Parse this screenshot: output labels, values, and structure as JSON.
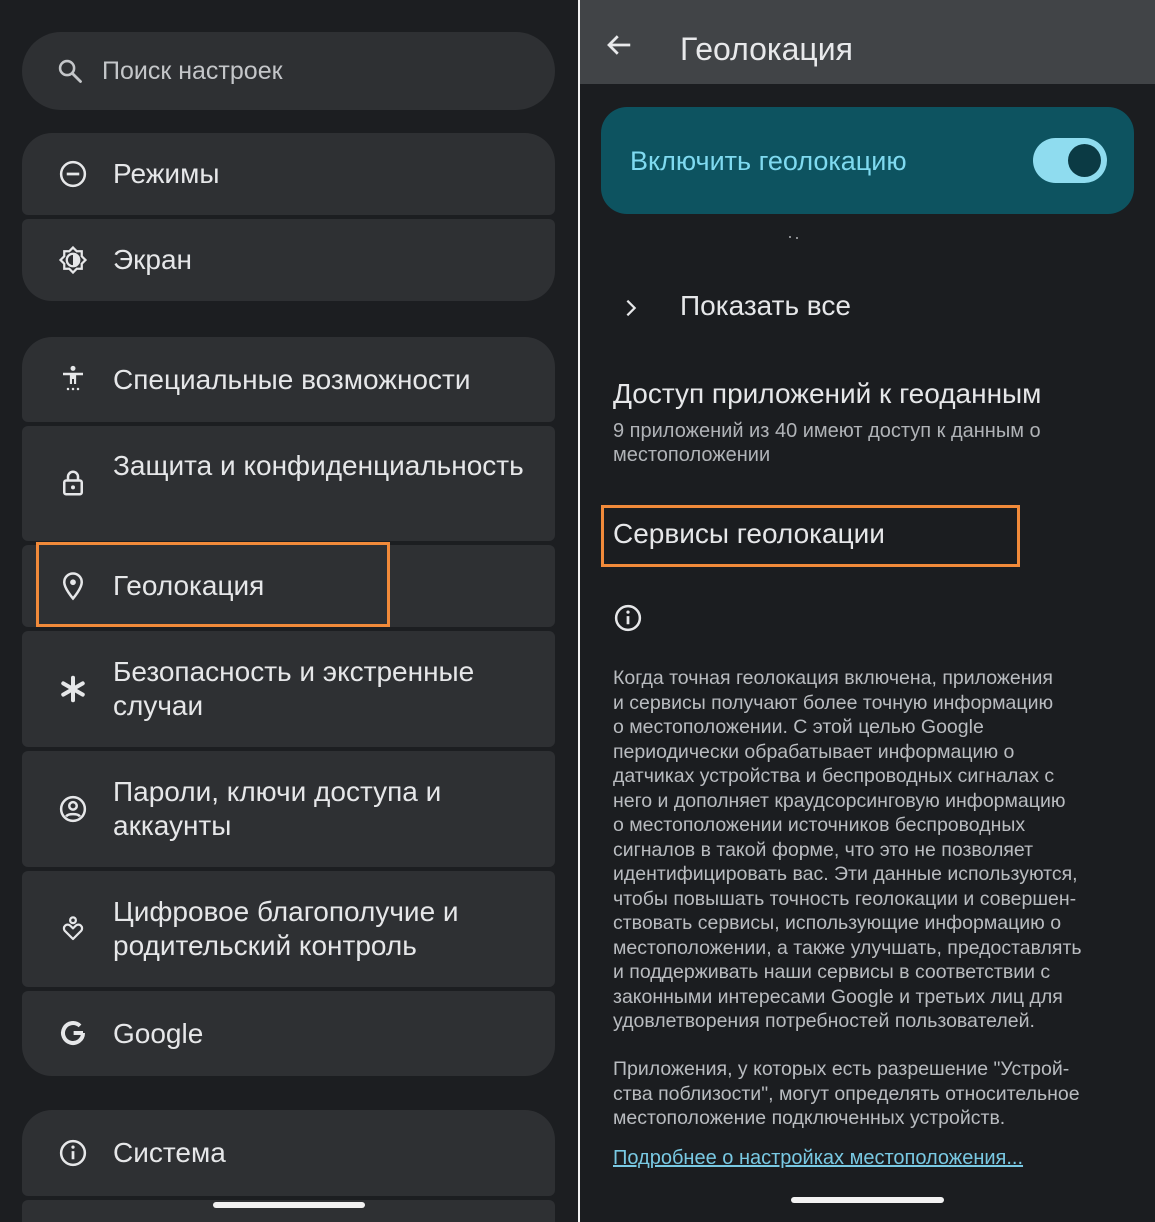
{
  "left": {
    "search_placeholder": "Поиск настроек",
    "items": [
      {
        "label": "Режимы",
        "icon": "do-not-disturb-icon"
      },
      {
        "label": "Экран",
        "icon": "brightness-icon"
      },
      {
        "label": "Специальные возможности",
        "icon": "accessibility-icon"
      },
      {
        "label": "Защита и конфиденциальность",
        "icon": "lock-icon"
      },
      {
        "label": "Геолокация",
        "icon": "location-pin-icon"
      },
      {
        "label": "Безопасность и экстренные случаи",
        "icon": "emergency-asterisk-icon"
      },
      {
        "label": "Пароли, ключи доступа и аккаунты",
        "icon": "account-circle-icon"
      },
      {
        "label": "Цифровое благополучие и родительский контроль",
        "icon": "wellbeing-icon"
      },
      {
        "label": "Google",
        "icon": "google-g-icon"
      },
      {
        "label": "Система",
        "icon": "info-icon"
      }
    ]
  },
  "right": {
    "title": "Геолокация",
    "toggle_label": "Включить геолокацию",
    "toggle_on": true,
    "show_all": "Показать все",
    "app_access_title": "Доступ приложений к геоданным",
    "app_access_subtitle": "9 приложений из 40 имеют доступ к данным о местоположении",
    "services_label": "Сервисы геолокации",
    "info_paragraph_1": "Когда точная геолокация включена, приложения\nи сервисы получают более точную информацию\nо местоположении. С этой целью Google\nпериодически обрабатывает информацию о\nдатчиках устройства и беспроводных сигналах с\nнего и дополняет краудсорсинговую информацию\nо местоположении источников беспроводных\nсигналов в такой форме, что это не позволяет\nидентифицировать вас. Эти данные используются,\nчтобы повышать точность геолокации и совершен-\nствовать сервисы, использующие информацию о\nместоположении, а также улучшать, предоставлять\nи поддерживать наши сервисы в соответствии с\nзаконными интересами Google и третьих лиц для\nудовлетворения потребностей пользователей.",
    "info_paragraph_2": "Приложения, у которых есть разрешение \"Устрой-\nства поблизости\", могут определять относительное\nместоположение подключенных устройств.",
    "learn_more_link": "Подробнее о настройках местоположения..."
  },
  "colors": {
    "accent_highlight": "#f18a3a",
    "toggle_card_bg": "#0d5360",
    "toggle_text": "#7fdaf0",
    "link": "#79c9e3"
  }
}
